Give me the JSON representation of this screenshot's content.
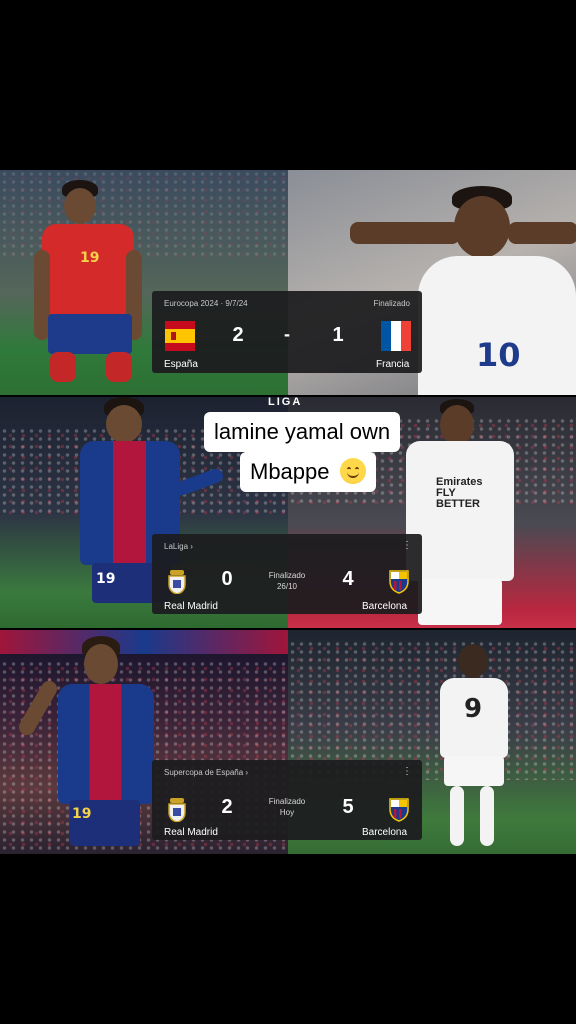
{
  "watermark": "LIGA",
  "caption": {
    "line1": "lamine yamal own",
    "line2": "Mbappe"
  },
  "emoji": "smiling-face-emoji",
  "match1": {
    "competition": "Eurocopa 2024 · 9/7/24",
    "status": "Finalizado",
    "home_team": "España",
    "away_team": "Francia",
    "home_score": "2",
    "separator": "-",
    "away_score": "1"
  },
  "match2": {
    "competition": "LaLiga ›",
    "status": "Finalizado",
    "date": "26/10",
    "home_team": "Real Madrid",
    "away_team": "Barcelona",
    "home_score": "0",
    "away_score": "4",
    "menu": "⋮"
  },
  "match3": {
    "competition": "Supercopa de España ›",
    "status": "Finalizado",
    "date": "Hoy",
    "home_team": "Real Madrid",
    "away_team": "Barcelona",
    "home_score": "2",
    "away_score": "5",
    "menu": "⋮"
  },
  "jerseys": {
    "yamal_spain": "19",
    "mbappe_france": "10",
    "yamal_barca_1": "19",
    "yamal_barca_2": "19",
    "mbappe_madrid": "9"
  },
  "sponsor": "Emirates FLY BETTER",
  "colors": {
    "card_bg": "#1c1c1e",
    "spain_red": "#d42a2a",
    "barca_blue": "#1a3a8c",
    "barca_garnet": "#b3163d"
  }
}
